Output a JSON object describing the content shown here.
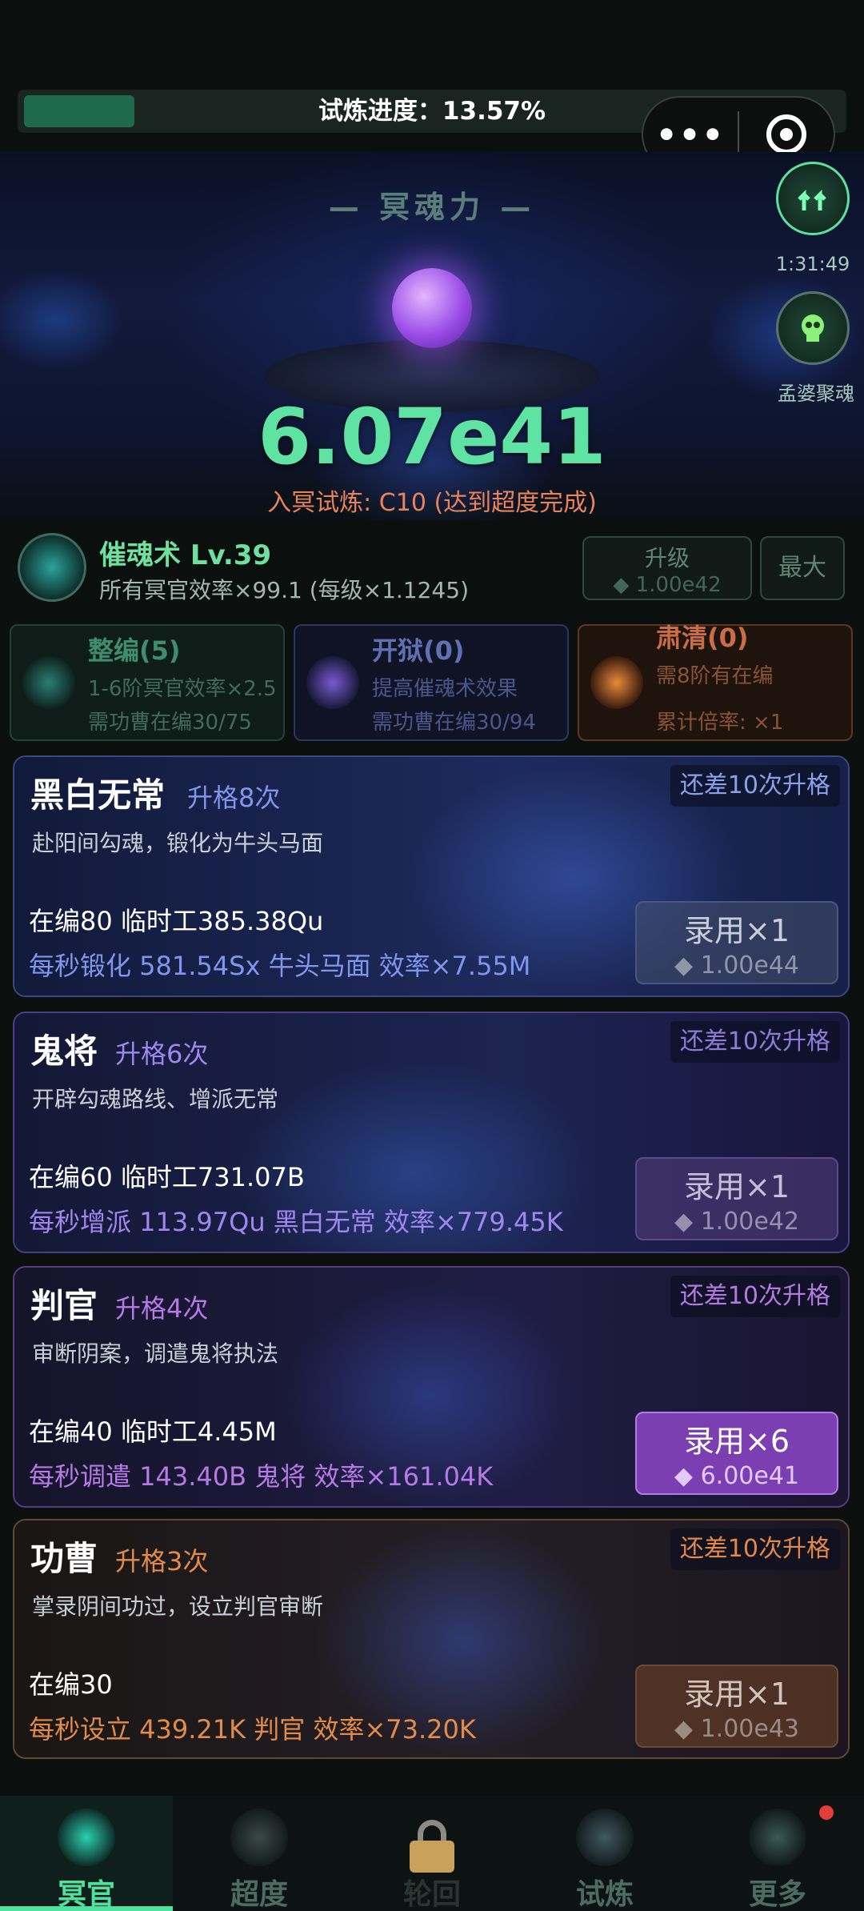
{
  "header": {
    "progress_text": "试炼进度：13.57%",
    "progress_fraction": 0.1357,
    "menu_dots": "•••"
  },
  "side": {
    "timer": "1:31:49",
    "meng_label": "孟婆聚魂"
  },
  "hero": {
    "title": "— 冥魂力 —",
    "value": "6.07e41",
    "trial": "入冥试炼: C10 (达到超度完成)"
  },
  "skill": {
    "name": "催魂术 Lv.39",
    "desc": "所有冥官效率×99.1 (每级×1.1245)",
    "upgrade_label": "升级",
    "upgrade_cost": "◆ 1.00e42",
    "max_label": "最大"
  },
  "mods": [
    {
      "title": "整编(5)",
      "line1": "1-6阶冥官效率×2.5",
      "line2": "需功曹在编30/75"
    },
    {
      "title": "开狱(0)",
      "line1": "提高催魂术效果",
      "line2": "需功曹在编30/94"
    },
    {
      "title": "肃清(0)",
      "line1": "需8阶有在编",
      "line2": "累计倍率: ×1"
    }
  ],
  "cards": [
    {
      "name": "黑白无常",
      "grade": "升格8次",
      "remain": "还差10次升格",
      "desc": "赴阳间勾魂，锻化为牛头马面",
      "staff": "在编80  临时工385.38Qu",
      "rate": "每秒锻化 581.54Sx 牛头马面  效率×7.55M",
      "hire": "录用×1",
      "cost": "◆ 1.00e44"
    },
    {
      "name": "鬼将",
      "grade": "升格6次",
      "remain": "还差10次升格",
      "desc": "开辟勾魂路线、增派无常",
      "staff": "在编60  临时工731.07B",
      "rate": "每秒增派 113.97Qu 黑白无常  效率×779.45K",
      "hire": "录用×1",
      "cost": "◆ 1.00e42"
    },
    {
      "name": "判官",
      "grade": "升格4次",
      "remain": "还差10次升格",
      "desc": "审断阴案，调遣鬼将执法",
      "staff": "在编40  临时工4.45M",
      "rate": "每秒调遣 143.40B 鬼将  效率×161.04K",
      "hire": "录用×6",
      "cost": "◆ 6.00e41"
    },
    {
      "name": "功曹",
      "grade": "升格3次",
      "remain": "还差10次升格",
      "desc": "掌录阴间功过，设立判官审断",
      "staff": "在编30",
      "rate": "每秒设立 439.21K 判官  效率×73.20K",
      "hire": "录用×1",
      "cost": "◆ 1.00e43"
    }
  ],
  "nav": [
    "冥官",
    "超度",
    "轮回",
    "试炼",
    "更多"
  ]
}
